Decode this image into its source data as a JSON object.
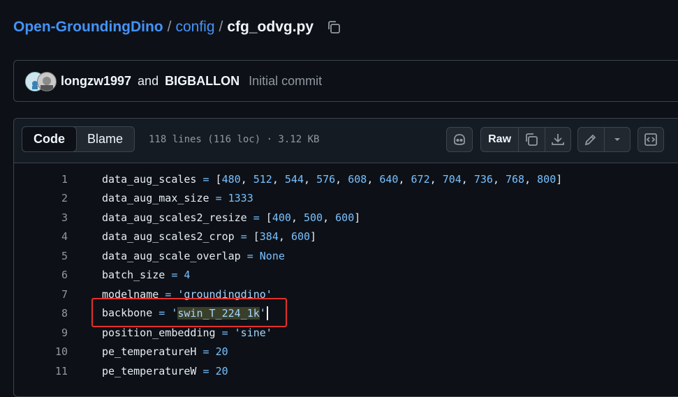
{
  "breadcrumb": {
    "repo": "Open-GroundingDino",
    "folder": "config",
    "file": "cfg_odvg.py",
    "sep": "/"
  },
  "commit": {
    "author1": "longzw1997",
    "and": "and",
    "author2": "BIGBALLON",
    "message": "Initial commit"
  },
  "file_header": {
    "code_tab": "Code",
    "blame_tab": "Blame",
    "meta": "118 lines (116 loc) · 3.12 KB",
    "raw_label": "Raw",
    "icons": [
      "copilot-icon",
      "copy-icon",
      "download-icon",
      "pencil-icon",
      "chevron-down-icon",
      "symbols-icon"
    ]
  },
  "code_lines": [
    {
      "n": "1",
      "tokens": [
        [
          "p",
          "data_aug_scales "
        ],
        [
          "op",
          "="
        ],
        [
          "p",
          " ["
        ],
        [
          "num",
          "480"
        ],
        [
          "p",
          ", "
        ],
        [
          "num",
          "512"
        ],
        [
          "p",
          ", "
        ],
        [
          "num",
          "544"
        ],
        [
          "p",
          ", "
        ],
        [
          "num",
          "576"
        ],
        [
          "p",
          ", "
        ],
        [
          "num",
          "608"
        ],
        [
          "p",
          ", "
        ],
        [
          "num",
          "640"
        ],
        [
          "p",
          ", "
        ],
        [
          "num",
          "672"
        ],
        [
          "p",
          ", "
        ],
        [
          "num",
          "704"
        ],
        [
          "p",
          ", "
        ],
        [
          "num",
          "736"
        ],
        [
          "p",
          ", "
        ],
        [
          "num",
          "768"
        ],
        [
          "p",
          ", "
        ],
        [
          "num",
          "800"
        ],
        [
          "p",
          "]"
        ]
      ]
    },
    {
      "n": "2",
      "tokens": [
        [
          "p",
          "data_aug_max_size "
        ],
        [
          "op",
          "="
        ],
        [
          "p",
          " "
        ],
        [
          "num",
          "1333"
        ]
      ]
    },
    {
      "n": "3",
      "tokens": [
        [
          "p",
          "data_aug_scales2_resize "
        ],
        [
          "op",
          "="
        ],
        [
          "p",
          " ["
        ],
        [
          "num",
          "400"
        ],
        [
          "p",
          ", "
        ],
        [
          "num",
          "500"
        ],
        [
          "p",
          ", "
        ],
        [
          "num",
          "600"
        ],
        [
          "p",
          "]"
        ]
      ]
    },
    {
      "n": "4",
      "tokens": [
        [
          "p",
          "data_aug_scales2_crop "
        ],
        [
          "op",
          "="
        ],
        [
          "p",
          " ["
        ],
        [
          "num",
          "384"
        ],
        [
          "p",
          ", "
        ],
        [
          "num",
          "600"
        ],
        [
          "p",
          "]"
        ]
      ]
    },
    {
      "n": "5",
      "tokens": [
        [
          "p",
          "data_aug_scale_overlap "
        ],
        [
          "op",
          "="
        ],
        [
          "p",
          " "
        ],
        [
          "kw",
          "None"
        ]
      ]
    },
    {
      "n": "6",
      "tokens": [
        [
          "p",
          "batch_size "
        ],
        [
          "op",
          "="
        ],
        [
          "p",
          " "
        ],
        [
          "num",
          "4"
        ]
      ]
    },
    {
      "n": "7",
      "tokens": [
        [
          "p",
          "modelname "
        ],
        [
          "op",
          "="
        ],
        [
          "p",
          " "
        ],
        [
          "str",
          "'groundingdino'"
        ]
      ]
    },
    {
      "n": "8",
      "tokens": [
        [
          "p",
          "backbone "
        ],
        [
          "op",
          "="
        ],
        [
          "p",
          " "
        ],
        [
          "str",
          "'"
        ],
        [
          "sel",
          "swin_T_224_1k"
        ],
        [
          "str",
          "'"
        ]
      ]
    },
    {
      "n": "9",
      "tokens": [
        [
          "p",
          "position_embedding "
        ],
        [
          "op",
          "="
        ],
        [
          "p",
          " "
        ],
        [
          "str",
          "'sine'"
        ]
      ]
    },
    {
      "n": "10",
      "tokens": [
        [
          "p",
          "pe_temperatureH "
        ],
        [
          "op",
          "="
        ],
        [
          "p",
          " "
        ],
        [
          "num",
          "20"
        ]
      ]
    },
    {
      "n": "11",
      "tokens": [
        [
          "p",
          "pe_temperatureW "
        ],
        [
          "op",
          "="
        ],
        [
          "p",
          " "
        ],
        [
          "num",
          "20"
        ]
      ]
    }
  ],
  "colors": {
    "accent": "#4493f8",
    "highlight": "#e5302b"
  }
}
